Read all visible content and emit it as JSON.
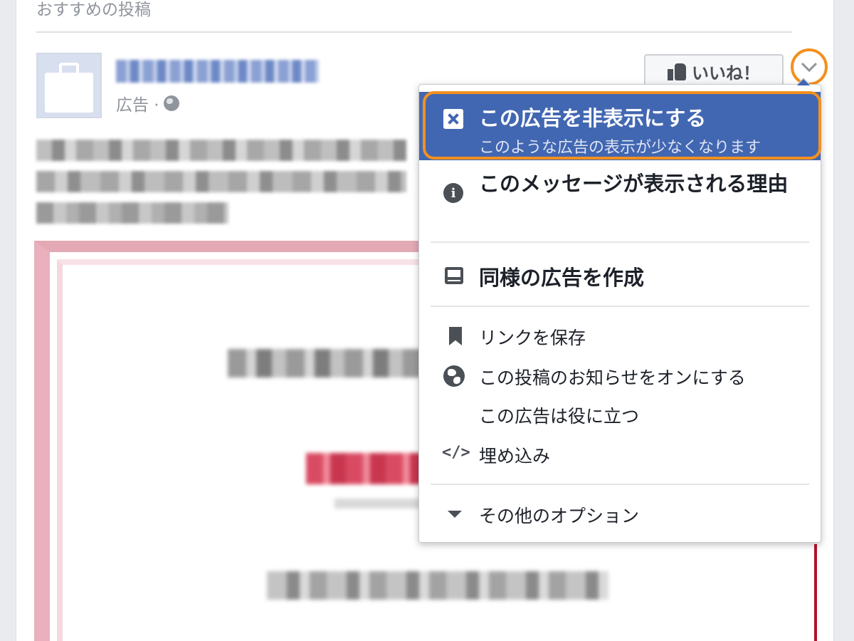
{
  "section_title": "おすすめの投稿",
  "post": {
    "sponsored_label": "広告 ·",
    "like_button_label": "いいね！"
  },
  "menu": {
    "hide_ad": {
      "title": "この広告を非表示にする",
      "subtitle": "このような広告の表示が少なくなります"
    },
    "why_seeing": "このメッセージが表示される理由",
    "create_similar": "同様の広告を作成",
    "save_link": "リンクを保存",
    "turn_on_notifications": "この投稿のお知らせをオンにする",
    "ad_useful": "この広告は役に立つ",
    "embed": "埋め込み",
    "embed_icon_glyph": "</>",
    "more_options": "その他のオプション"
  },
  "colors": {
    "facebook_blue": "#4267b2",
    "highlight_orange": "#f4901e"
  },
  "icons": [
    "close-icon",
    "info-icon",
    "create-ad-icon",
    "bookmark-icon",
    "globe-icon",
    "embed-icon",
    "triangle-down-icon",
    "thumbs-up-icon",
    "chevron-down-icon"
  ]
}
